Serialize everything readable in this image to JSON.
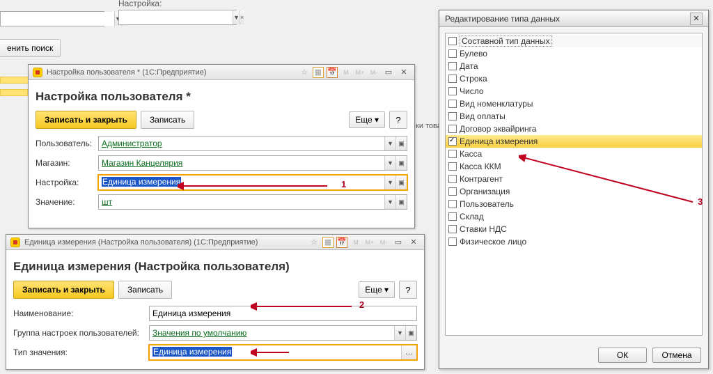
{
  "top": {
    "setting_label": "Настройка:",
    "apply_search": "енить поиск"
  },
  "peek_text": "ки товаров",
  "win1": {
    "title": "Настройка пользователя * (1С:Предприятие)",
    "heading": "Настройка пользователя *",
    "save_close": "Записать и закрыть",
    "save": "Записать",
    "more": "Еще",
    "labels": {
      "user": "Пользователь:",
      "store": "Магазин:",
      "setting": "Настройка:",
      "value": "Значение:"
    },
    "user": "Администратор",
    "store": "Магазин Канцелярия",
    "setting": "Единица измерения",
    "value": "шт"
  },
  "win2": {
    "title": "Единица измерения (Настройка пользователя) (1С:Предприятие)",
    "heading": "Единица измерения (Настройка пользователя)",
    "save_close": "Записать и закрыть",
    "save": "Записать",
    "more": "Еще",
    "labels": {
      "name": "Наименование:",
      "group": "Группа настроек пользователей:",
      "type": "Тип значения:"
    },
    "name": "Единица измерения",
    "group": "Значения по умолчанию",
    "type": "Единица измерения"
  },
  "dialog": {
    "title": "Редактирование типа данных",
    "ok": "ОК",
    "cancel": "Отмена",
    "items": [
      {
        "label": "Составной тип данных",
        "checked": false,
        "header": true
      },
      {
        "label": "Булево",
        "checked": false
      },
      {
        "label": "Дата",
        "checked": false
      },
      {
        "label": "Строка",
        "checked": false
      },
      {
        "label": "Число",
        "checked": false
      },
      {
        "label": "Вид номенклатуры",
        "checked": false
      },
      {
        "label": "Вид оплаты",
        "checked": false
      },
      {
        "label": "Договор эквайринга",
        "checked": false
      },
      {
        "label": "Единица измерения",
        "checked": true,
        "selected": true
      },
      {
        "label": "Касса",
        "checked": false
      },
      {
        "label": "Касса ККМ",
        "checked": false
      },
      {
        "label": "Контрагент",
        "checked": false
      },
      {
        "label": "Организация",
        "checked": false
      },
      {
        "label": "Пользователь",
        "checked": false
      },
      {
        "label": "Склад",
        "checked": false
      },
      {
        "label": "Ставки НДС",
        "checked": false
      },
      {
        "label": "Физическое лицо",
        "checked": false
      }
    ]
  },
  "marks": {
    "one": "1",
    "two": "2",
    "three": "3"
  }
}
